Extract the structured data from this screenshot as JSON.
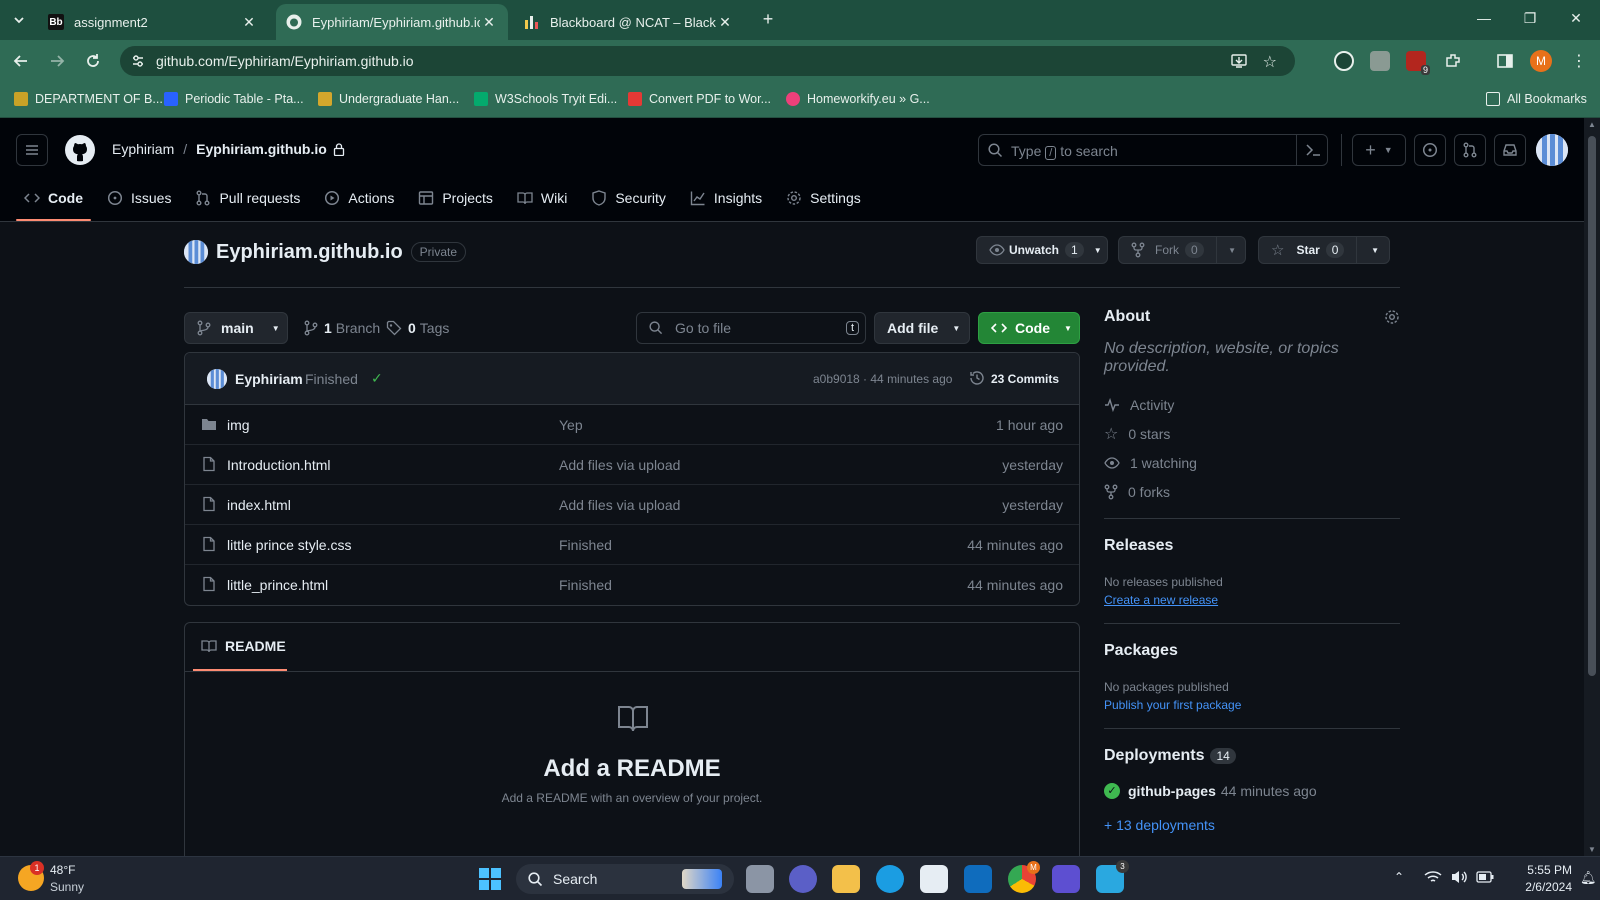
{
  "browser": {
    "tabs": [
      {
        "title": "assignment2",
        "favicon": "Bb"
      },
      {
        "title": "Eyphiriam/Eyphiriam.github.io",
        "favicon": "github-icon"
      },
      {
        "title": "Blackboard @ NCAT – Blackboa",
        "favicon": "chart-icon"
      }
    ],
    "url": "github.com/Eyphiriam/Eyphiriam.github.io",
    "profile_initial": "M",
    "ext_badge": "9",
    "bookmarks": [
      "DEPARTMENT OF B...",
      "Periodic Table - Pta...",
      "Undergraduate Han...",
      "W3Schools Tryit Edi...",
      "Convert PDF to Wor...",
      "Homeworkify.eu » G..."
    ],
    "all_bookmarks": "All Bookmarks"
  },
  "header": {
    "owner": "Eyphiriam",
    "separator": "/",
    "repo": "Eyphiriam.github.io",
    "search_placeholder_pre": "Type",
    "search_key": "/",
    "search_placeholder_post": "to search",
    "nav": [
      "Code",
      "Issues",
      "Pull requests",
      "Actions",
      "Projects",
      "Wiki",
      "Security",
      "Insights",
      "Settings"
    ]
  },
  "repo": {
    "name": "Eyphiriam.github.io",
    "visibility": "Private",
    "unwatch_label": "Unwatch",
    "watch_count": "1",
    "fork_label": "Fork",
    "fork_count": "0",
    "star_label": "Star",
    "star_count": "0",
    "branch": "main",
    "branch_count": "1",
    "branch_label": "Branch",
    "tag_count": "0",
    "tag_label": "Tags",
    "goto_placeholder": "Go to file",
    "goto_key": "t",
    "add_file_label": "Add file",
    "code_label": "Code"
  },
  "commit": {
    "author": "Eyphiriam",
    "message": "Finished",
    "sha_time": "a0b9018 · 44 minutes ago",
    "commits": "23 Commits"
  },
  "files": [
    {
      "name": "img",
      "type": "folder",
      "message": "Yep",
      "time": "1 hour ago"
    },
    {
      "name": "Introduction.html",
      "type": "file",
      "message": "Add files via upload",
      "time": "yesterday"
    },
    {
      "name": "index.html",
      "type": "file",
      "message": "Add files via upload",
      "time": "yesterday"
    },
    {
      "name": "little prince style.css",
      "type": "file",
      "message": "Finished",
      "time": "44 minutes ago"
    },
    {
      "name": "little_prince.html",
      "type": "file",
      "message": "Finished",
      "time": "44 minutes ago"
    }
  ],
  "readme": {
    "tab": "README",
    "title": "Add a README",
    "subtitle": "Add a README with an overview of your project."
  },
  "about": {
    "heading": "About",
    "description": "No description, website, or topics provided.",
    "activity": "Activity",
    "stars": "0 stars",
    "watching": "1 watching",
    "forks": "0 forks"
  },
  "releases": {
    "heading": "Releases",
    "text": "No releases published",
    "link": "Create a new release"
  },
  "packages": {
    "heading": "Packages",
    "text": "No packages published",
    "link": "Publish your first package"
  },
  "deployments": {
    "heading": "Deployments",
    "count": "14",
    "env": "github-pages",
    "time": "44 minutes ago",
    "more": "+ 13 deployments"
  },
  "taskbar": {
    "temp": "48°F",
    "condition": "Sunny",
    "weather_badge": "1",
    "search": "Search",
    "time": "5:55 PM",
    "date": "2/6/2024",
    "teams_badge": "3",
    "chrome_badge": "M"
  },
  "colors": {
    "accent_green": "#238636",
    "link_blue": "#4493f8",
    "tab_underline": "#fd8c73",
    "chrome_bg": "#2f6b55"
  }
}
